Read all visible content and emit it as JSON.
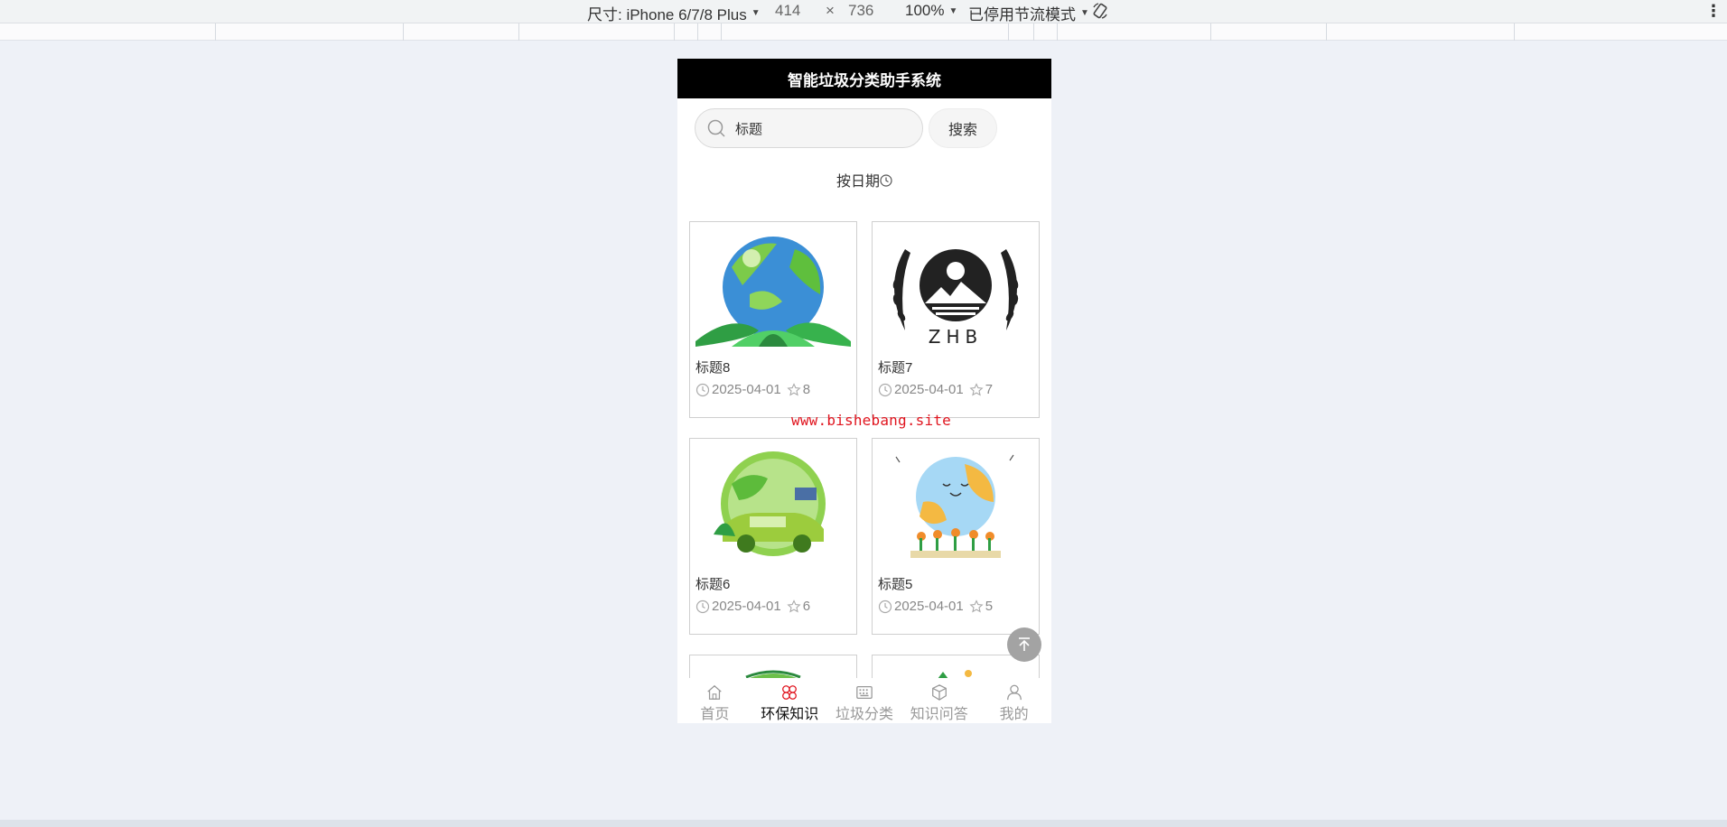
{
  "devtools": {
    "size_label": "尺寸: iPhone 6/7/8 Plus",
    "width": "414",
    "times": "×",
    "height": "736",
    "zoom": "100%",
    "throttle": "已停用节流模式",
    "more": "⋮"
  },
  "app": {
    "title": "智能垃圾分类助手系统",
    "search": {
      "value": "标题",
      "button": "搜索"
    },
    "sort_label": "按日期",
    "cards": [
      {
        "title": "标题8",
        "date": "2025-04-01",
        "favs": "8",
        "image": "earth-leaves-illustration"
      },
      {
        "title": "标题7",
        "date": "2025-04-01",
        "favs": "7",
        "image": "zhb-environmental-emblem"
      },
      {
        "title": "标题6",
        "date": "2025-04-01",
        "favs": "6",
        "image": "green-car-earth-illustration"
      },
      {
        "title": "标题5",
        "date": "2025-04-01",
        "favs": "5",
        "image": "smiling-earth-flowers-illustration"
      }
    ],
    "watermark": "www.bishebang.site",
    "tabs": [
      {
        "label": "首页",
        "icon": "home-icon",
        "active": false
      },
      {
        "label": "环保知识",
        "icon": "clover-icon",
        "active": true
      },
      {
        "label": "垃圾分类",
        "icon": "keyboard-icon",
        "active": false
      },
      {
        "label": "知识问答",
        "icon": "cube-icon",
        "active": false
      },
      {
        "label": "我的",
        "icon": "user-icon",
        "active": false
      }
    ],
    "colors": {
      "accent": "#e0141e",
      "header": "#000000",
      "active_tab_icon": "#e0141e"
    }
  }
}
